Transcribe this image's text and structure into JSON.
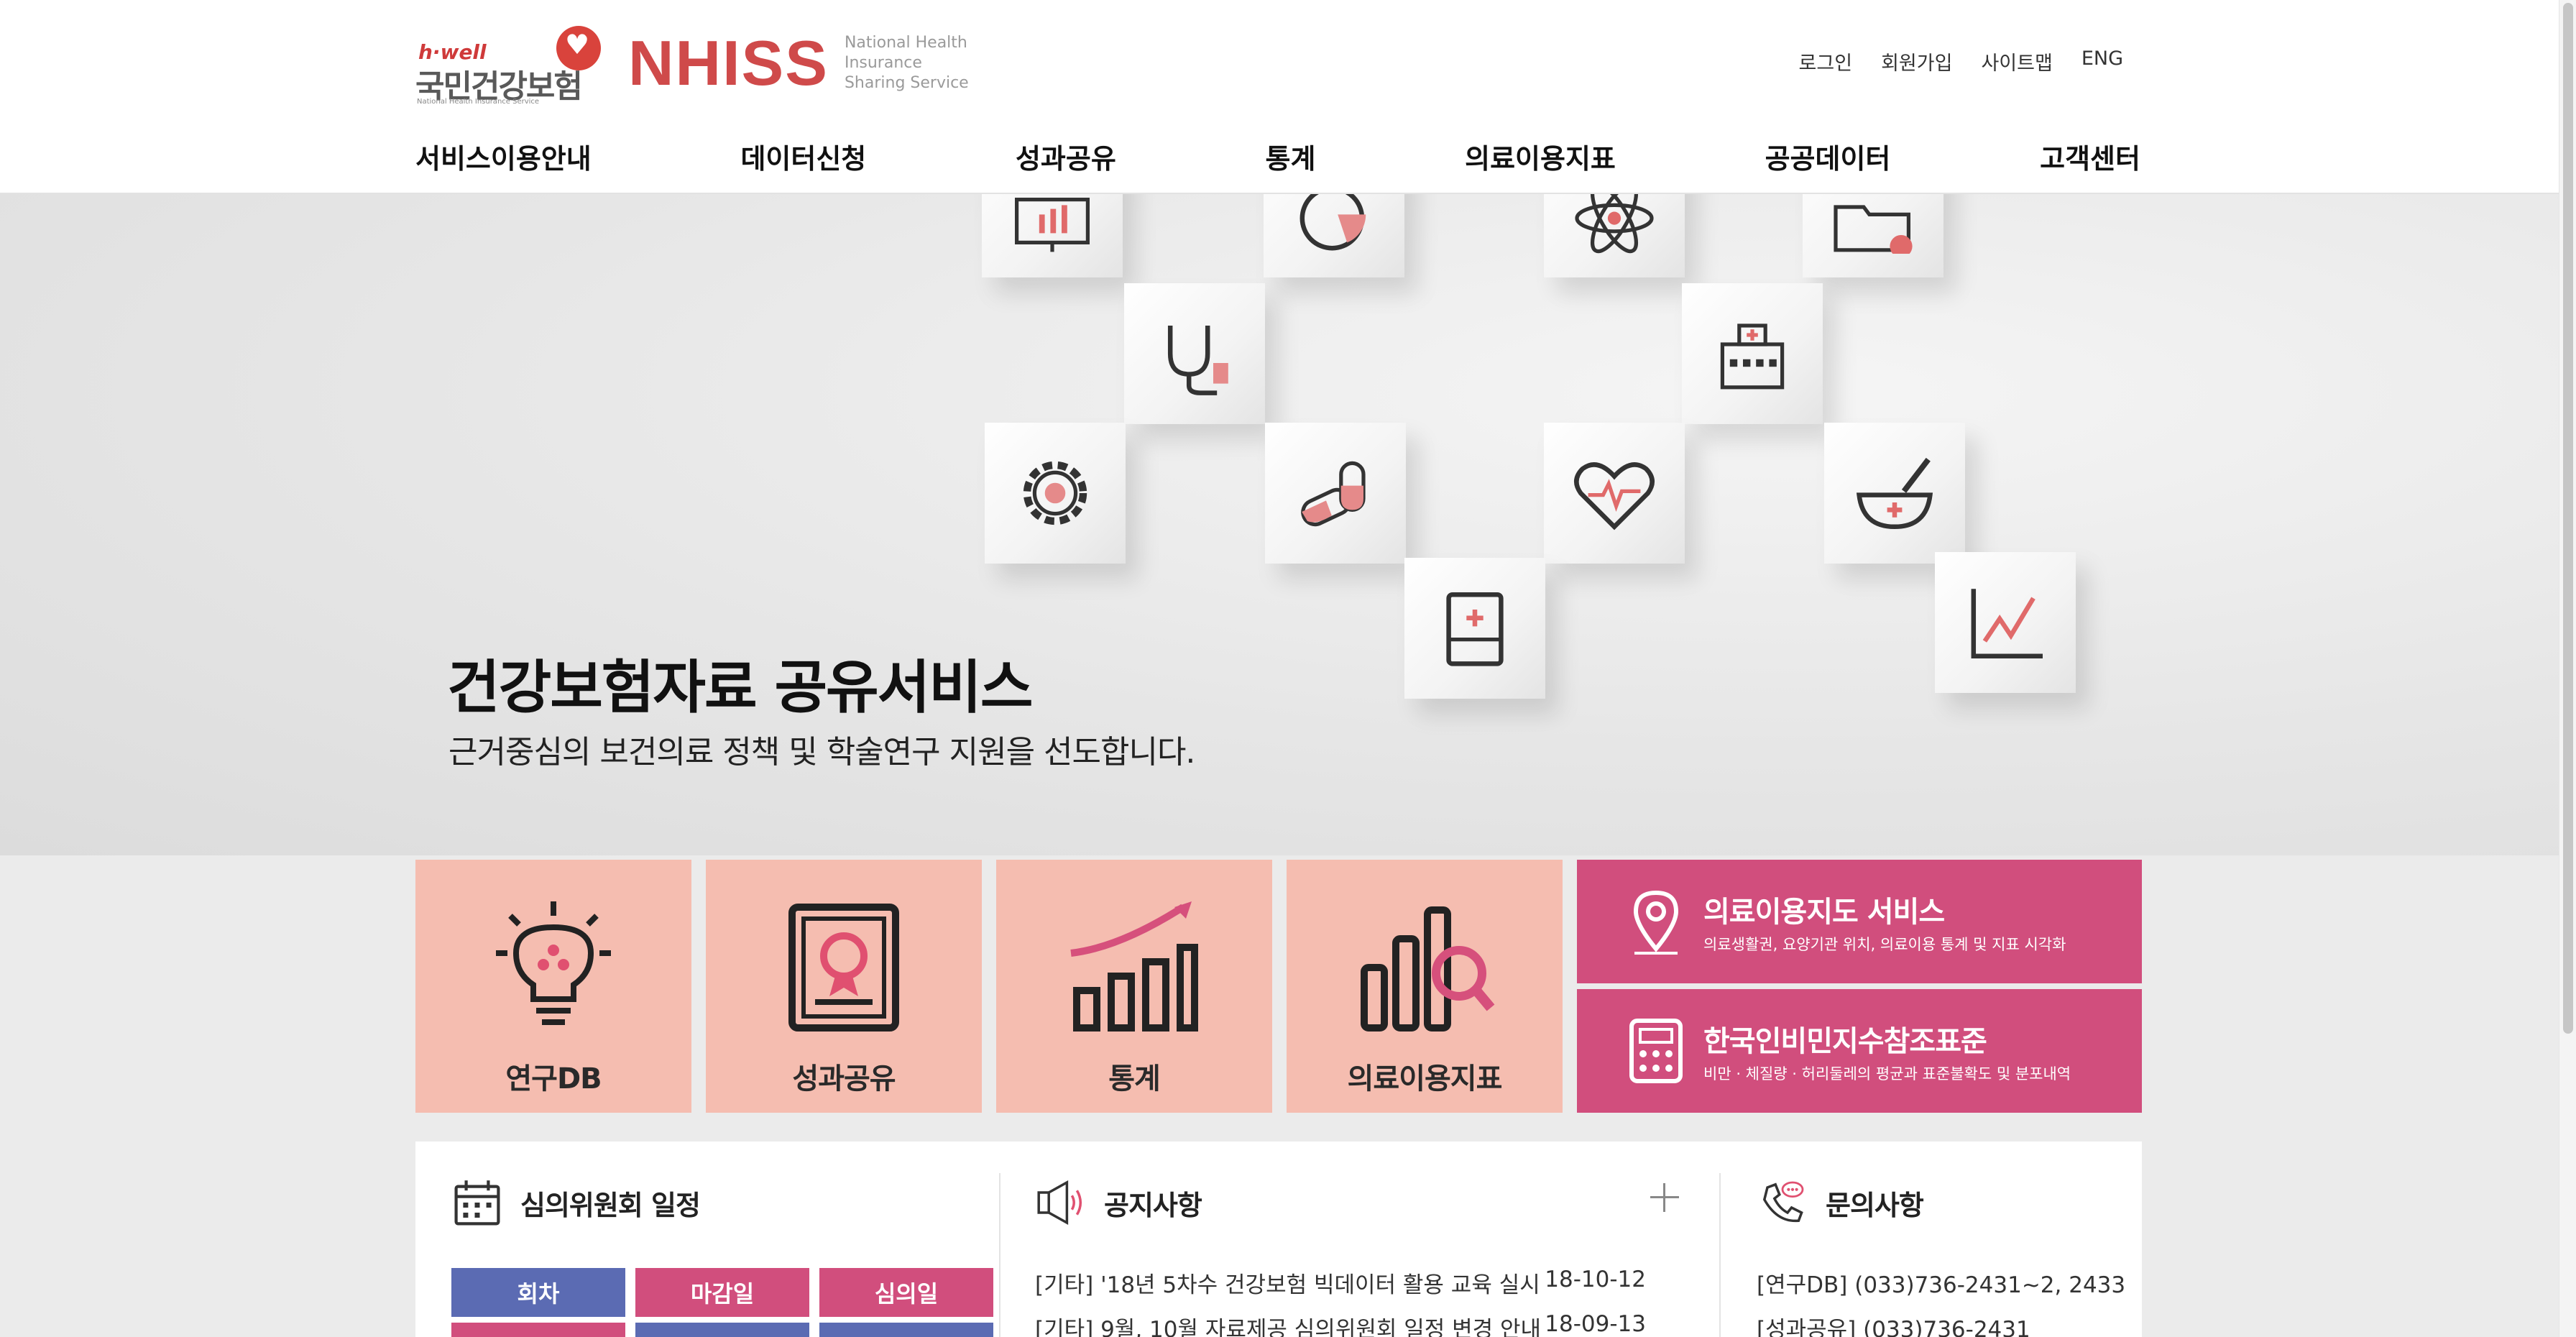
{
  "header": {
    "logo": {
      "hwell_small": "h·well",
      "hwell_name": "국민건강보험",
      "hwell_sub": "National Health Insurance Service",
      "nhiss": "NHISS",
      "nhiss_sub_line1": "National Health Insurance",
      "nhiss_sub_line2": "Sharing Service"
    },
    "util_links": [
      "로그인",
      "회원가입",
      "사이트맵",
      "ENG"
    ],
    "gnb": [
      "서비스이용안내",
      "데이터신청",
      "성과공유",
      "통계",
      "의료이용지표",
      "공공데이터",
      "고객센터"
    ]
  },
  "hero": {
    "title": "건강보험자료 공유서비스",
    "subtitle": "근거중심의 보건의료 정책 및 학술연구 지원을 선도합니다.",
    "cube_icons": [
      "presentation-board-icon",
      "pie-chart-icon",
      "atom-icon",
      "folder-check-icon",
      "stethoscope-icon",
      "hospital-icon",
      "gear-icon",
      "pill-capsule-icon",
      "heart-pulse-icon",
      "mortar-pestle-icon",
      "medical-box-icon",
      "line-chart-icon"
    ]
  },
  "tiles": [
    {
      "label": "연구DB",
      "icon": "lightbulb-icon"
    },
    {
      "label": "성과공유",
      "icon": "certificate-icon"
    },
    {
      "label": "통계",
      "icon": "growth-chart-icon"
    },
    {
      "label": "의료이용지표",
      "icon": "bar-search-icon"
    }
  ],
  "pink_tiles": [
    {
      "title": "의료이용지도 서비스",
      "desc": "의료생활권, 요양기관 위치, 의료이용 통계 및 지표 시각화",
      "icon": "map-pin-icon"
    },
    {
      "title": "한국인비민지수참조표준",
      "desc": "비만 · 체질량 · 허리둘레의 평균과 표준불확도 및 분포내역",
      "icon": "calculator-icon"
    }
  ],
  "committee": {
    "title": "심의위원회 일정",
    "headers": [
      "회차",
      "마감일",
      "심의일"
    ]
  },
  "notices": {
    "title": "공지사항",
    "items": [
      {
        "text": "[기타] '18년 5차수 건강보험 빅데이터 활용 교육 실시",
        "date": "18-10-12"
      },
      {
        "text": "[기타] 9월, 10월 자료제공 심의위원회 일정 변경 안내",
        "date": "18-09-13"
      }
    ]
  },
  "inquiry": {
    "title": "문의사항",
    "items": [
      "[연구DB] (033)736-2431~2, 2433",
      "[성과공유] (033)736-2431"
    ]
  },
  "colors": {
    "brand_red": "#cf4a4a",
    "tile_salmon": "#f5bdb0",
    "tile_pink": "#d14e7d",
    "sched_blue": "#5b6bb3",
    "sched_pink": "#d14e7d"
  }
}
